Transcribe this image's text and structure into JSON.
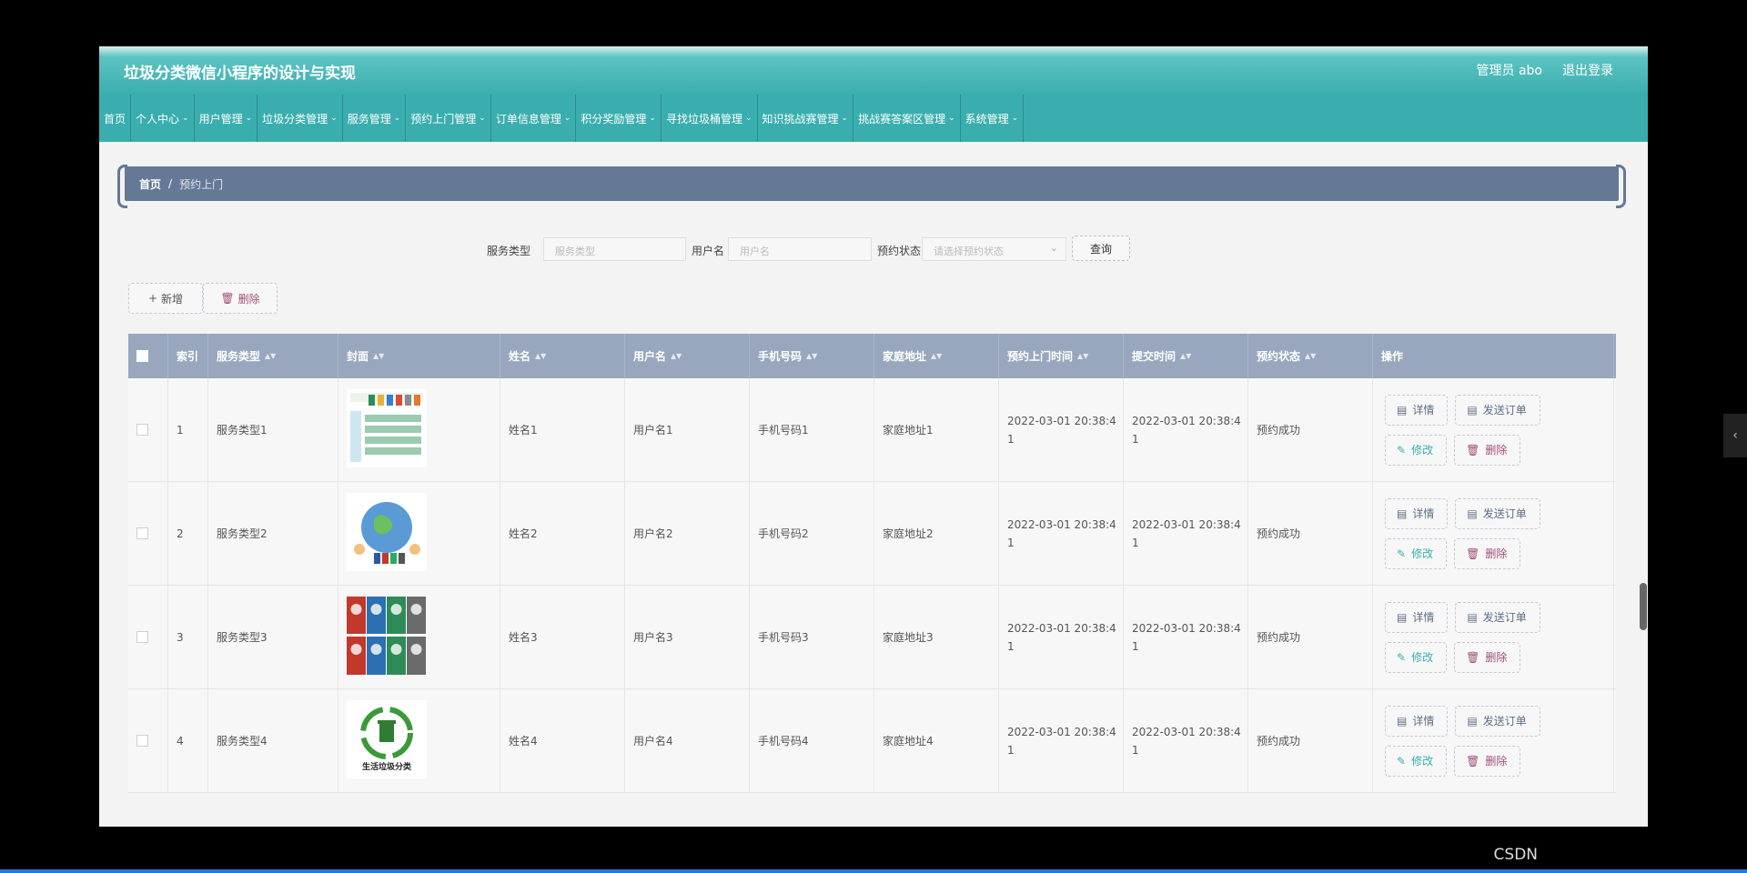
{
  "header": {
    "title": "垃圾分类微信小程序的设计与实现",
    "user": "管理员 abo",
    "logout": "退出登录"
  },
  "nav": [
    "首页",
    "个人中心",
    "用户管理",
    "垃圾分类管理",
    "服务管理",
    "预约上门管理",
    "订单信息管理",
    "积分奖励管理",
    "寻找垃圾桶管理",
    "知识挑战赛管理",
    "挑战赛答案区管理",
    "系统管理"
  ],
  "breadcrumb": {
    "home": "首页",
    "sep": "/",
    "current": "预约上门"
  },
  "search": {
    "service_label": "服务类型",
    "service_placeholder": "服务类型",
    "user_label": "用户名",
    "user_placeholder": "用户名",
    "status_label": "预约状态",
    "status_placeholder": "请选择预约状态",
    "query": "查询"
  },
  "toolbar": {
    "add": "新增",
    "delete": "删除"
  },
  "columns": [
    "索引",
    "服务类型",
    "封面",
    "姓名",
    "用户名",
    "手机号码",
    "家庭地址",
    "预约上门时间",
    "提交时间",
    "预约状态",
    "操作"
  ],
  "rows": [
    {
      "index": "1",
      "service": "服务类型1",
      "name": "姓名1",
      "user": "用户名1",
      "phone": "手机号码1",
      "address": "家庭地址1",
      "visit": "2022-03-01 20:38:41",
      "submit": "2022-03-01 20:38:41",
      "status": "预约成功",
      "cover": "poster-icon"
    },
    {
      "index": "2",
      "service": "服务类型2",
      "name": "姓名2",
      "user": "用户名2",
      "phone": "手机号码2",
      "address": "家庭地址2",
      "visit": "2022-03-01 20:38:41",
      "submit": "2022-03-01 20:38:41",
      "status": "预约成功",
      "cover": "globe-icon"
    },
    {
      "index": "3",
      "service": "服务类型3",
      "name": "姓名3",
      "user": "用户名3",
      "phone": "手机号码3",
      "address": "家庭地址3",
      "visit": "2022-03-01 20:38:41",
      "submit": "2022-03-01 20:38:41",
      "status": "预约成功",
      "cover": "bins-icon"
    },
    {
      "index": "4",
      "service": "服务类型4",
      "name": "姓名4",
      "user": "用户名4",
      "phone": "手机号码4",
      "address": "家庭地址4",
      "visit": "2022-03-01 20:38:41",
      "submit": "2022-03-01 20:38:41",
      "status": "预约成功",
      "cover": "recycle-icon",
      "cover_caption": "生活垃圾分类"
    }
  ],
  "actions": {
    "detail": "详情",
    "send": "发送订单",
    "edit": "修改",
    "delete": "删除"
  },
  "watermark": "CSDN"
}
